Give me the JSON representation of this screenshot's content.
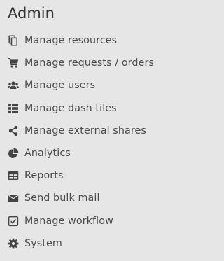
{
  "header": {
    "title": "Admin"
  },
  "menu": {
    "items": [
      {
        "label": "Manage resources",
        "icon": "files-icon"
      },
      {
        "label": "Manage requests / orders",
        "icon": "shopping-cart-icon"
      },
      {
        "label": "Manage users",
        "icon": "users-icon"
      },
      {
        "label": "Manage dash tiles",
        "icon": "grid-icon"
      },
      {
        "label": "Manage external shares",
        "icon": "share-icon"
      },
      {
        "label": "Analytics",
        "icon": "pie-chart-icon"
      },
      {
        "label": "Reports",
        "icon": "table-icon"
      },
      {
        "label": "Send bulk mail",
        "icon": "envelope-icon"
      },
      {
        "label": "Manage workflow",
        "icon": "checkbox-icon"
      },
      {
        "label": "System",
        "icon": "gear-icon"
      }
    ]
  },
  "colors": {
    "background": "#e6e6e6",
    "text": "#404040",
    "icon": "#444444"
  }
}
